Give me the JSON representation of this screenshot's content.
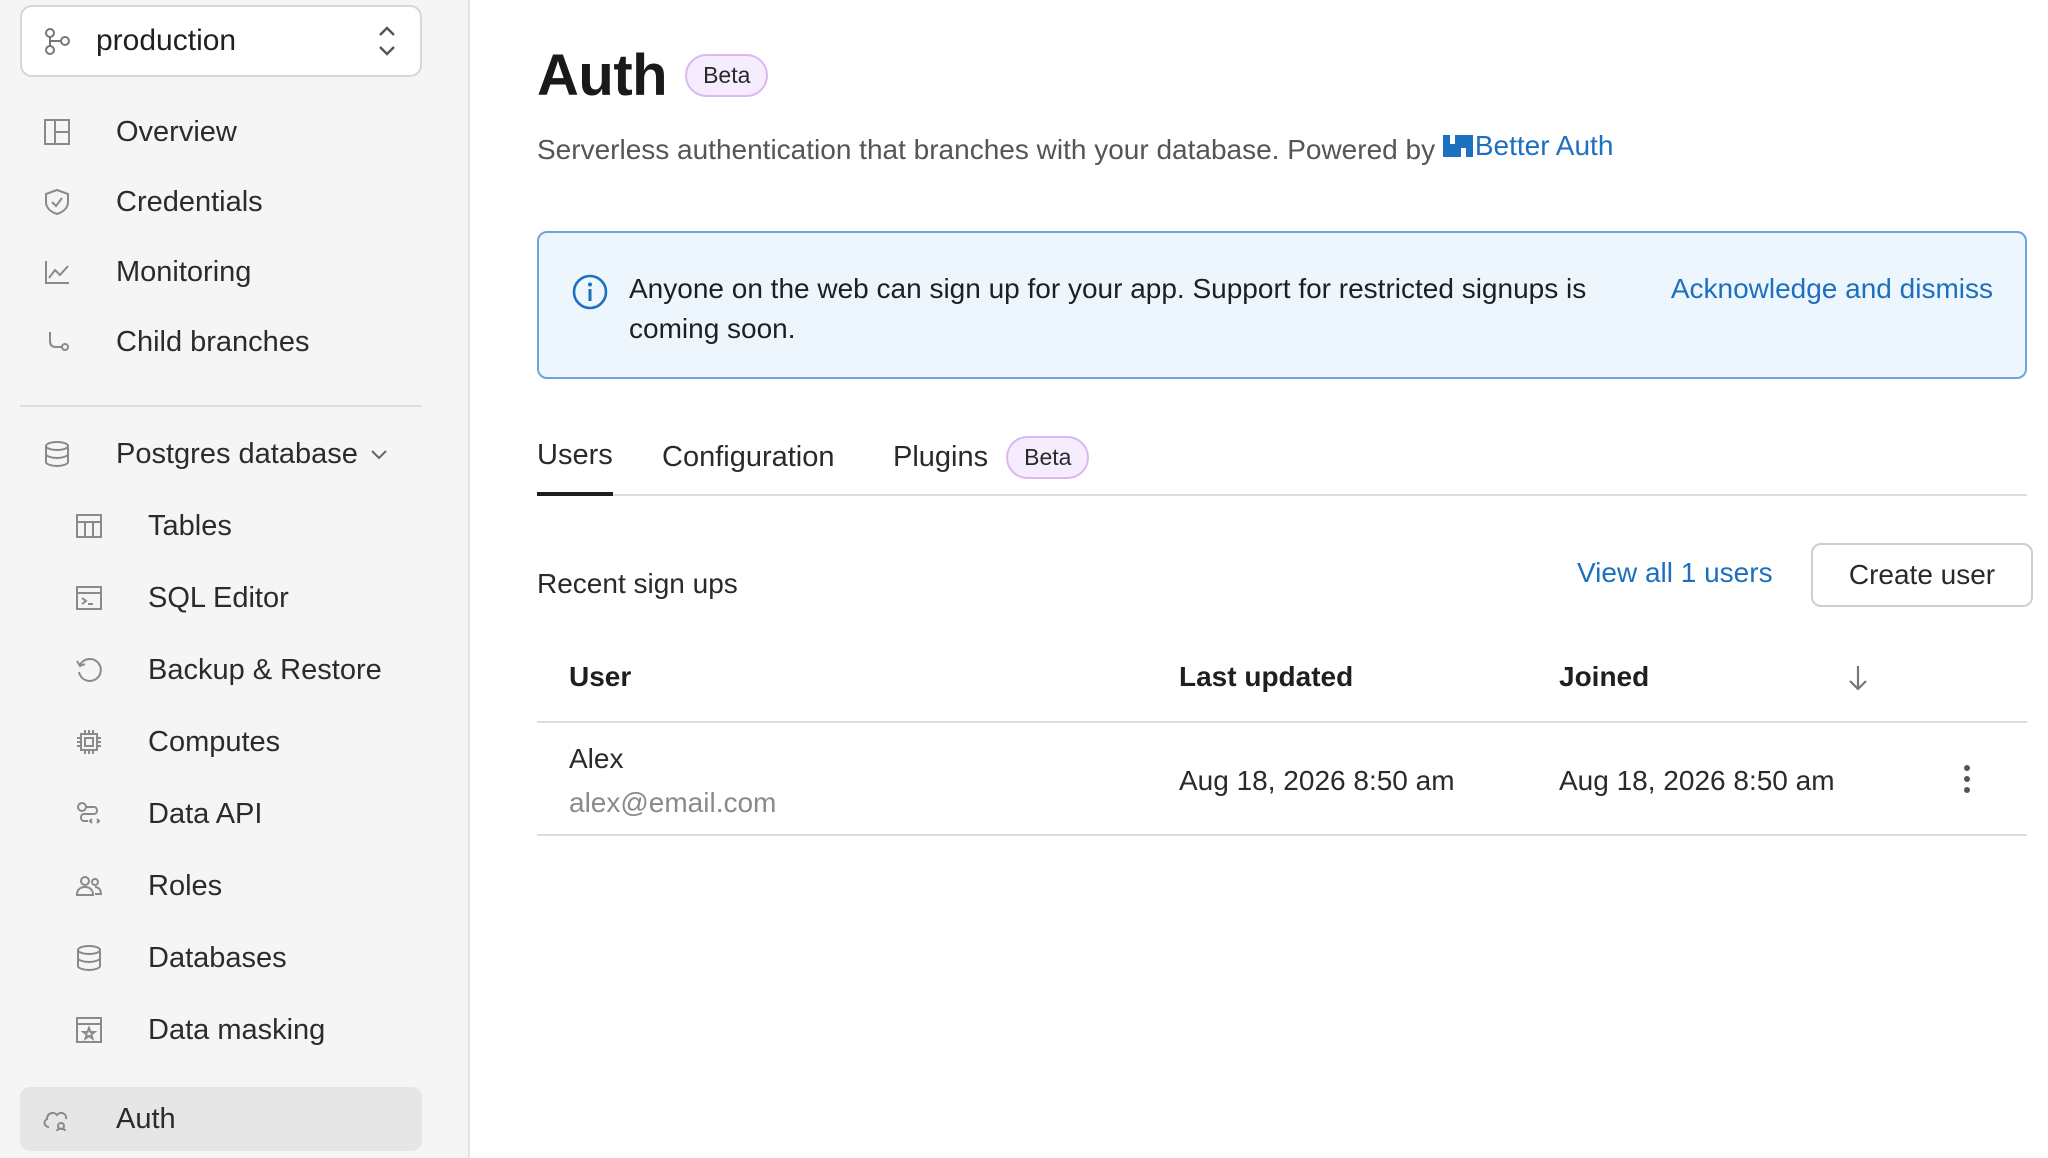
{
  "sidebar": {
    "branch": "production",
    "top_items": [
      {
        "label": "Overview",
        "icon": "layout-grid-icon"
      },
      {
        "label": "Credentials",
        "icon": "shield-check-icon"
      },
      {
        "label": "Monitoring",
        "icon": "line-chart-icon"
      },
      {
        "label": "Child branches",
        "icon": "branch-icon"
      }
    ],
    "group": {
      "label": "Postgres database",
      "icon": "database-icon",
      "expanded": true
    },
    "sub_items": [
      {
        "label": "Tables",
        "icon": "table-icon"
      },
      {
        "label": "SQL Editor",
        "icon": "terminal-icon"
      },
      {
        "label": "Backup & Restore",
        "icon": "restore-icon"
      },
      {
        "label": "Computes",
        "icon": "cpu-icon"
      },
      {
        "label": "Data API",
        "icon": "api-icon"
      },
      {
        "label": "Roles",
        "icon": "users-icon"
      },
      {
        "label": "Databases",
        "icon": "database-icon"
      },
      {
        "label": "Data masking",
        "icon": "masking-icon"
      }
    ],
    "active_item": {
      "label": "Auth",
      "icon": "auth-cloud-icon"
    }
  },
  "header": {
    "title": "Auth",
    "badge": "Beta",
    "subtitle": "Serverless authentication that branches with your database. Powered by",
    "powered_link": "Better Auth"
  },
  "alert": {
    "message": "Anyone on the web can sign up for your app. Support for restricted signups is coming soon.",
    "action": "Acknowledge and dismiss"
  },
  "tabs": [
    {
      "label": "Users",
      "active": true
    },
    {
      "label": "Configuration",
      "active": false
    },
    {
      "label": "Plugins",
      "active": false,
      "badge": "Beta"
    }
  ],
  "users_section": {
    "title": "Recent sign ups",
    "view_all": "View all 1 users",
    "create_button": "Create user",
    "columns": [
      "User",
      "Last updated",
      "Joined"
    ],
    "rows": [
      {
        "name": "Alex",
        "email": "alex@email.com",
        "last_updated": "Aug 18, 2026 8:50 am",
        "joined": "Aug 18, 2026 8:50 am"
      }
    ]
  },
  "colors": {
    "accent": "#1d6fbf",
    "beta_bg": "#f5ecfd",
    "beta_border": "#d9b8f3",
    "alert_bg": "#eef6fd",
    "alert_border": "#6ea4dd"
  }
}
